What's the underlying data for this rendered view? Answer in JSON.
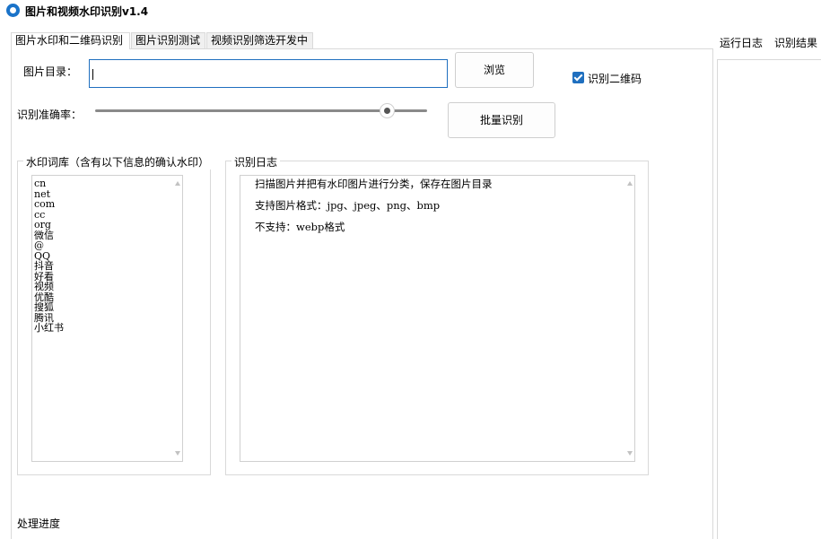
{
  "window": {
    "title": "图片和视频水印识别v1.4"
  },
  "tabs": [
    {
      "label": "图片水印和二维码识别"
    },
    {
      "label": "图片识别测试"
    },
    {
      "label": "视频识别筛选开发中"
    }
  ],
  "right_tabs": [
    {
      "label": "运行日志"
    },
    {
      "label": "识别结果"
    }
  ],
  "form": {
    "dir_label": "图片目录：",
    "dir_value": "",
    "browse_label": "浏览",
    "qr_checkbox_label": "识别二维码",
    "qr_checked": true,
    "accuracy_label": "识别准确率：",
    "accuracy_value": 0.88,
    "batch_label": "批量识别",
    "progress_label": "处理进度"
  },
  "keywords_group": {
    "title": "水印词库（含有以下信息的确认水印）",
    "items": [
      "cn",
      "net",
      "com",
      "cc",
      "org",
      "微信",
      "@",
      "QQ",
      "抖音",
      "好看",
      "视频",
      "优酷",
      "搜狐",
      "腾讯",
      "小红书"
    ]
  },
  "log_group": {
    "title": "识别日志",
    "lines": [
      "扫描图片并把有水印图片进行分类，保存在图片目录",
      "支持图片格式：jpg、jpeg、png、bmp",
      "不支持：webp格式"
    ]
  },
  "colors": {
    "accent": "#1f6fbf",
    "border": "#d9d9d9"
  }
}
